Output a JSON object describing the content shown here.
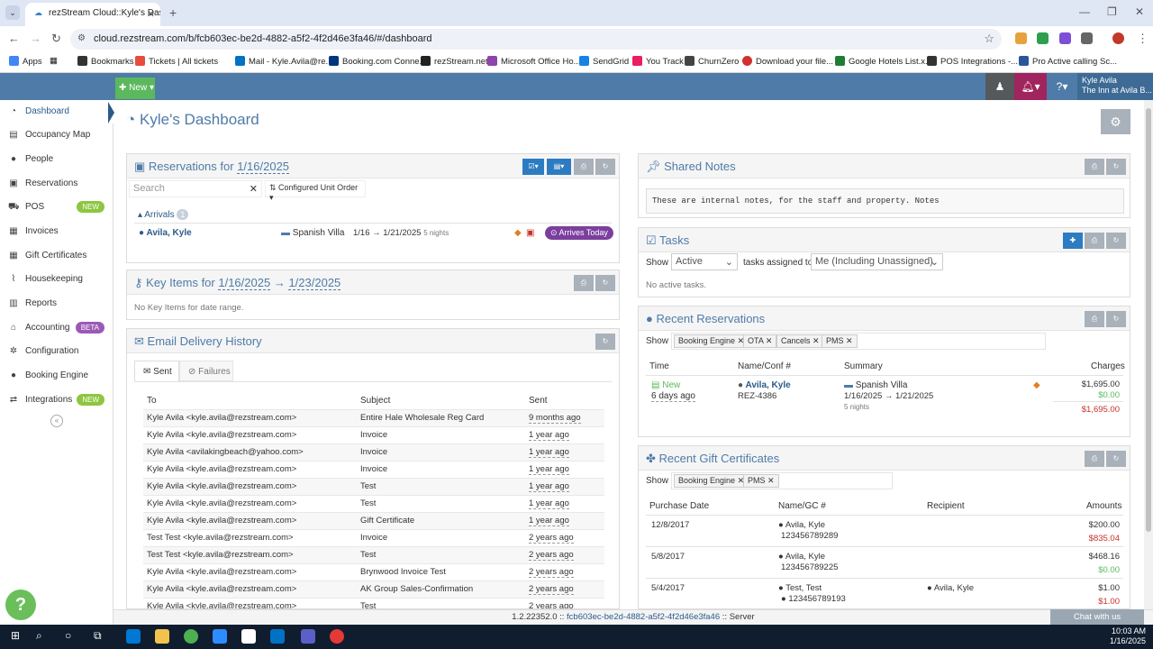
{
  "browser": {
    "tab_title": "rezStream Cloud::Kyle's Dashbo",
    "url": "cloud.rezstream.com/b/fcb603ec-be2d-4882-a5f2-4f2d46e3fa46/#/dashboard",
    "bookmarks": [
      "Apps",
      "Bookmarks",
      "Tickets | All tickets",
      "Mail - Kyle.Avila@re...",
      "Booking.com Conne...",
      "rezStream.net",
      "Microsoft Office Ho...",
      "SendGrid",
      "You Track",
      "ChurnZero",
      "Download your file...",
      "Google Hotels List.x...",
      "POS Integrations -...",
      "Pro Active calling Sc..."
    ]
  },
  "header": {
    "new_label": "New",
    "user_name": "Kyle Avila",
    "user_property": "The Inn at Avila B..."
  },
  "sidebar": {
    "items": [
      {
        "label": "Dashboard",
        "icon": "dashboard-icon"
      },
      {
        "label": "Occupancy Map",
        "icon": "calendar-icon"
      },
      {
        "label": "People",
        "icon": "person-icon"
      },
      {
        "label": "Reservations",
        "icon": "briefcase-icon"
      },
      {
        "label": "POS",
        "icon": "cart-icon",
        "badge": "NEW"
      },
      {
        "label": "Invoices",
        "icon": "table-icon"
      },
      {
        "label": "Gift Certificates",
        "icon": "grid-icon"
      },
      {
        "label": "Housekeeping",
        "icon": "broom-icon"
      },
      {
        "label": "Reports",
        "icon": "chart-icon"
      },
      {
        "label": "Accounting",
        "icon": "bank-icon",
        "badge": "BETA"
      },
      {
        "label": "Configuration",
        "icon": "cogs-icon"
      },
      {
        "label": "Booking Engine",
        "icon": "globe-icon"
      },
      {
        "label": "Integrations",
        "icon": "exchange-icon",
        "badge": "NEW"
      }
    ]
  },
  "page": {
    "title": "Kyle's Dashboard"
  },
  "reservations_panel": {
    "title_prefix": "Reservations for",
    "date": "1/16/2025",
    "search_placeholder": "Search",
    "order_label": "Configured Unit Order",
    "arrivals_label": "Arrivals",
    "arrivals_count": "1",
    "guest": "Avila, Kyle",
    "unit": "Spanish Villa",
    "dates": "1/16 → 1/21/2025",
    "nights": "5 nights",
    "status": "Arrives Today"
  },
  "key_items_panel": {
    "title_prefix": "Key Items for",
    "date_from": "1/16/2025",
    "arrow": "→",
    "date_to": "1/23/2025",
    "empty": "No Key Items for date range."
  },
  "email_panel": {
    "title": "Email Delivery History",
    "tab_sent": "Sent",
    "tab_failures": "Failures",
    "columns": [
      "To",
      "Subject",
      "Sent"
    ],
    "rows": [
      {
        "to": "Kyle Avila <kyle.avila@rezstream.com>",
        "subject": "Entire Hale Wholesale Reg Card",
        "sent": "9 months ago"
      },
      {
        "to": "Kyle Avila <kyle.avila@rezstream.com>",
        "subject": "Invoice",
        "sent": "1 year ago"
      },
      {
        "to": "Kyle Avila <avilakingbeach@yahoo.com>",
        "subject": "Invoice",
        "sent": "1 year ago"
      },
      {
        "to": "Kyle Avila <kyle.avila@rezstream.com>",
        "subject": "Invoice",
        "sent": "1 year ago"
      },
      {
        "to": "Kyle Avila <kyle.avila@rezstream.com>",
        "subject": "Test",
        "sent": "1 year ago"
      },
      {
        "to": "Kyle Avila <kyle.avila@rezstream.com>",
        "subject": "Test",
        "sent": "1 year ago"
      },
      {
        "to": "Kyle Avila <kyle.avila@rezstream.com>",
        "subject": "Gift Certificate",
        "sent": "1 year ago"
      },
      {
        "to": "Test Test <kyle.avila@rezstream.com>",
        "subject": "Invoice",
        "sent": "2 years ago"
      },
      {
        "to": "Test Test <kyle.avila@rezstream.com>",
        "subject": "Test",
        "sent": "2 years ago"
      },
      {
        "to": "Kyle Avila <kyle.avila@rezstream.com>",
        "subject": "Brynwood Invoice Test",
        "sent": "2 years ago"
      },
      {
        "to": "Kyle Avila <kyle.avila@rezstream.com>",
        "subject": "AK Group Sales-Confirmation",
        "sent": "2 years ago"
      },
      {
        "to": "Kyle Avila <kyle.avila@rezstream.com>",
        "subject": "Test",
        "sent": "2 years ago"
      }
    ]
  },
  "notes_panel": {
    "title": "Shared Notes",
    "text": "These are internal notes, for the staff and property. Notes"
  },
  "tasks_panel": {
    "title": "Tasks",
    "show_label": "Show",
    "status_value": "Active",
    "assigned_label": "tasks assigned to",
    "assignee_value": "Me (Including Unassigned)",
    "empty": "No active tasks."
  },
  "recent_res_panel": {
    "title": "Recent Reservations",
    "show_label": "Show",
    "filters": [
      "Booking Engine",
      "OTA",
      "Cancels",
      "PMS"
    ],
    "columns": [
      "Time",
      "Name/Conf #",
      "Summary",
      "Charges"
    ],
    "row": {
      "status": "New",
      "time": "6 days ago",
      "name": "Avila, Kyle",
      "conf": "REZ-4386",
      "unit": "Spanish Villa",
      "dates": "1/16/2025 → 1/21/2025",
      "nights": "5 nights",
      "charge1": "$1,695.00",
      "charge2": "$0.00",
      "charge3": "$1,695.00"
    }
  },
  "gift_panel": {
    "title": "Recent Gift Certificates",
    "show_label": "Show",
    "filters": [
      "Booking Engine",
      "PMS"
    ],
    "columns": [
      "Purchase Date",
      "Name/GC #",
      "Recipient",
      "Amounts"
    ],
    "rows": [
      {
        "date": "12/8/2017",
        "name": "Avila, Kyle",
        "gc": "123456789289",
        "recipient": "",
        "amount1": "$200.00",
        "amount2": "$835.04",
        "amount2_color": "#c9302c"
      },
      {
        "date": "5/8/2017",
        "name": "Avila, Kyle",
        "gc": "123456789225",
        "recipient": "",
        "amount1": "$468.16",
        "amount2": "$0.00",
        "amount2_color": "#5cb85c"
      },
      {
        "date": "5/4/2017",
        "name": "Test, Test",
        "gc": "123456789193",
        "recipient": "Avila, Kyle",
        "amount1": "$1.00",
        "amount2": "$1.00",
        "amount2_color": "#c9302c"
      }
    ]
  },
  "footer": {
    "version": "1.2.22352.0 :: ",
    "build_id": "fcb603ec-be2d-4882-a5f2-4f2d46e3fa46",
    "server": " :: Server",
    "chat": "Chat with us",
    "time": "10:03 AM",
    "date": "1/16/2025"
  },
  "colors": {
    "brand": "#4f7ba8",
    "accent_green": "#5cb85c",
    "status_purple": "#7b3f9e",
    "danger": "#c9302c"
  }
}
